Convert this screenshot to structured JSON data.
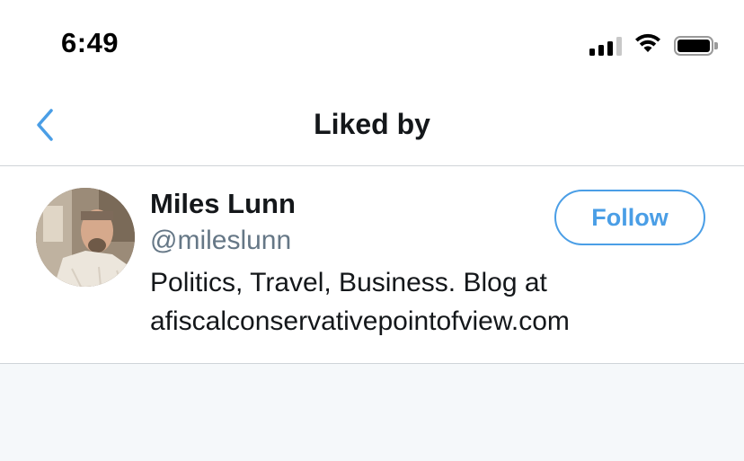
{
  "status_bar": {
    "time": "6:49",
    "signal_bars_filled": 3,
    "signal_bars_total": 4,
    "wifi_icon": "wifi-icon",
    "battery_icon": "battery-icon"
  },
  "nav": {
    "back_icon": "chevron-left-icon",
    "title": "Liked by"
  },
  "users": [
    {
      "name": "Miles Lunn",
      "handle": "@mileslunn",
      "bio": "Politics, Travel, Business. Blog at afiscalconservativepointofview.com",
      "follow_label": "Follow"
    }
  ],
  "colors": {
    "accent": "#4a9ee6",
    "text_primary": "#14171a",
    "text_secondary": "#657786",
    "background_empty": "#f5f8fa"
  }
}
